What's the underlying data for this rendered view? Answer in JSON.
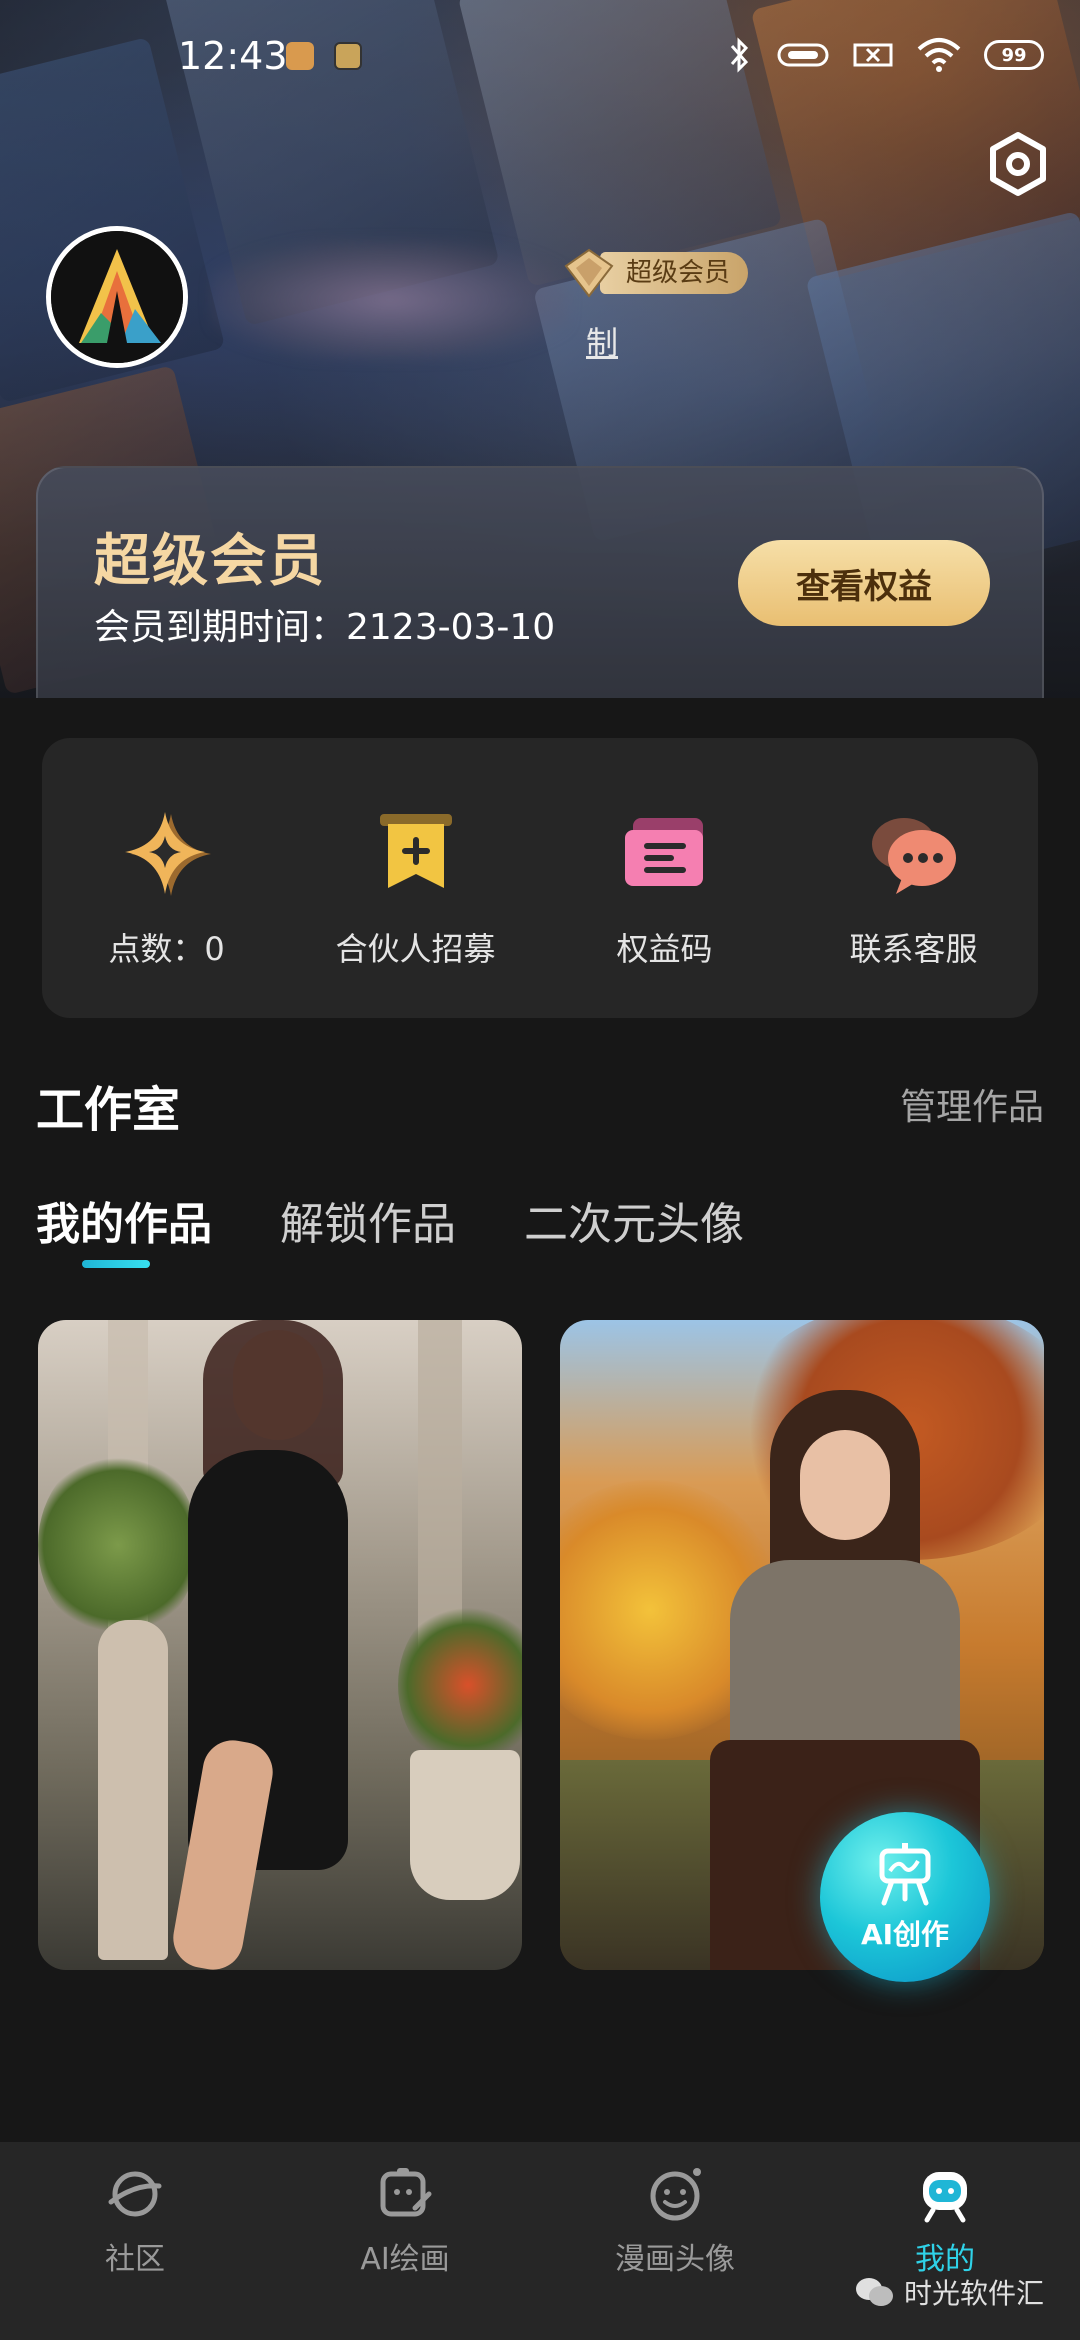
{
  "status_bar": {
    "time": "12:43",
    "battery": "99"
  },
  "profile": {
    "vip_badge": "超级会员",
    "partial_text": "制"
  },
  "member_card": {
    "title": "超级会员",
    "expiry": "会员到期时间：2123-03-10",
    "button": "查看权益"
  },
  "quick_actions": [
    {
      "label": "点数：0",
      "icon": "sparkle-points-icon"
    },
    {
      "label": "合伙人招募",
      "icon": "partner-bookmark-icon"
    },
    {
      "label": "权益码",
      "icon": "ticket-icon"
    },
    {
      "label": "联系客服",
      "icon": "chat-bubble-icon"
    }
  ],
  "studio": {
    "title": "工作室",
    "manage": "管理作品",
    "tabs": [
      "我的作品",
      "解锁作品",
      "二次元头像"
    ],
    "active_tab": 0
  },
  "fab": {
    "label": "AI创作"
  },
  "bottom_nav": [
    {
      "label": "社区",
      "icon": "planet-icon"
    },
    {
      "label": "AI绘画",
      "icon": "ai-paint-icon"
    },
    {
      "label": "漫画头像",
      "icon": "smiley-icon"
    },
    {
      "label": "我的",
      "icon": "robot-profile-icon"
    }
  ],
  "nav_active": 3,
  "watermark": "时光软件汇",
  "colors": {
    "accent": "#2fd2e8",
    "gold": "#f5d7a3",
    "background": "#171717",
    "panel": "#262626"
  }
}
